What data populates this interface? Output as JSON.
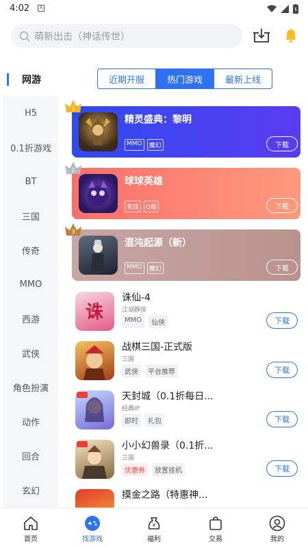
{
  "status": {
    "time": "4:02",
    "notif": "A"
  },
  "search": {
    "placeholder": "萌新出击（神话传世）"
  },
  "sidebar": {
    "active": "网游",
    "items": [
      "H5",
      "0.1折游戏",
      "BT",
      "三国",
      "传奇",
      "MMO",
      "西游",
      "武侠",
      "角色扮演",
      "动作",
      "回合",
      "玄幻"
    ]
  },
  "tabs": [
    {
      "label": "近期开服",
      "active": false
    },
    {
      "label": "热门游戏",
      "active": true
    },
    {
      "label": "最新上线",
      "active": false
    }
  ],
  "top_cards": [
    {
      "rank": "1",
      "name": "精灵盛典：黎明",
      "tags": [
        "MMO",
        "魔幻"
      ],
      "button": "下载",
      "color": "#3d48f2"
    },
    {
      "rank": "2",
      "name": "球球英雄",
      "tags": [
        "竞技",
        "Q版"
      ],
      "button": "下载",
      "color": "#fb7a6e"
    },
    {
      "rank": "3",
      "name": "混沌起源（新）",
      "tags": [
        "MMO",
        "魔幻"
      ],
      "button": "下载",
      "color": "#c9a4a0"
    }
  ],
  "games": [
    {
      "name": "诛仙-4",
      "sub": "江湖群侠",
      "tags": [
        {
          "t": "MMO",
          "red": false
        },
        {
          "t": "仙侠",
          "red": false
        }
      ],
      "button": "下载"
    },
    {
      "name": "战棋三国-正式版",
      "sub": "三国",
      "tags": [
        {
          "t": "武侠",
          "red": false
        },
        {
          "t": "平台推荐",
          "red": false
        }
      ],
      "button": "下载"
    },
    {
      "name": "天封城（0.1折每日...",
      "sub": "经典IP",
      "tags": [
        {
          "t": "即时",
          "red": false
        },
        {
          "t": "礼包",
          "red": false
        }
      ],
      "button": "下载"
    },
    {
      "name": "小小幻兽录（0.1折...",
      "sub": "三国",
      "tags": [
        {
          "t": "优惠券",
          "red": true
        },
        {
          "t": "放置挂机",
          "red": false
        }
      ],
      "button": "下载"
    },
    {
      "name": "摸金之路（特惠神...",
      "sub": "",
      "tags": [],
      "button": ""
    }
  ],
  "nav": [
    {
      "label": "首页",
      "icon": "home-icon",
      "active": false
    },
    {
      "label": "找游戏",
      "icon": "find-game-icon",
      "active": true
    },
    {
      "label": "福利",
      "icon": "welfare-icon",
      "active": false
    },
    {
      "label": "交易",
      "icon": "trade-icon",
      "active": false
    },
    {
      "label": "我的",
      "icon": "profile-icon",
      "active": false
    }
  ],
  "colors": {
    "accent": "#2d72f5",
    "rank1": "#3d48f2",
    "rank2": "#fb7a6e",
    "rank3": "#c9a4a0"
  }
}
